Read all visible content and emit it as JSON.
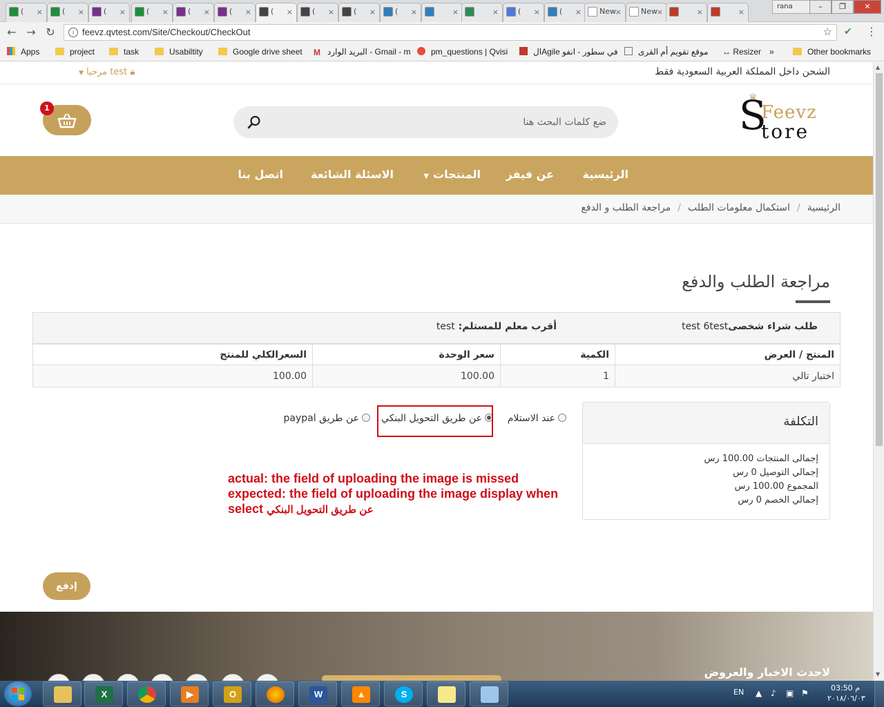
{
  "browser": {
    "tabs": [
      {
        "label": "(",
        "color": "#1e8e3e"
      },
      {
        "label": "(",
        "color": "#1e8e3e"
      },
      {
        "label": "(",
        "color": "#7a2e8e"
      },
      {
        "label": "(",
        "color": "#1e8e3e"
      },
      {
        "label": "(",
        "color": "#7a2e8e"
      },
      {
        "label": "(",
        "color": "#7a2e8e"
      },
      {
        "label": "(",
        "color": "#444444"
      },
      {
        "label": "(",
        "color": "#444444"
      },
      {
        "label": "(",
        "color": "#444444"
      },
      {
        "label": "(",
        "color": "#2f7fbf"
      },
      {
        "label": "",
        "color": "#2f7fbf"
      },
      {
        "label": "",
        "color": "#2e8b57"
      },
      {
        "label": "(",
        "color": "#4a7cd9"
      },
      {
        "label": "(",
        "color": "#2f7fbf"
      },
      {
        "label": "New",
        "color": "#ffffff"
      },
      {
        "label": "New",
        "color": "#ffffff"
      },
      {
        "label": "",
        "color": "#c0392b"
      },
      {
        "label": "",
        "color": "#c0392b"
      }
    ],
    "user": "rana",
    "url": "feevz.qvtest.com/Site/Checkout/CheckOut",
    "bookmarks": {
      "apps": "Apps",
      "project": "project",
      "task": "task",
      "usability": "Usabiltity",
      "drive": "Google drive sheet",
      "gmail": "البريد الوارد - Gmail - m",
      "pm": "pm_questions | Qvisi",
      "agile": "الAgile في سطور - انفو",
      "umm": "موقع تقويم أم القرى",
      "resizer": "↔ Resizer",
      "more": "»",
      "other": "Other bookmarks"
    }
  },
  "site": {
    "shipping_note": "الشحن داخل المملكة العربية السعودية فقط",
    "welcome": "مرحبا test",
    "logo": {
      "top": "Feevz",
      "bottom": "tore",
      "initial": "S"
    },
    "search_placeholder": "ضع كلمات البحث هنا",
    "cart_count": "1",
    "nav": {
      "home": "الرئيسية",
      "about": "عن فيفز",
      "products": "المنتجات",
      "faq": "الاسئلة الشائعة",
      "contact": "اتصل بنا"
    },
    "breadcrumb": {
      "home": "الرئيسية",
      "info": "استكمال معلومات الطلب",
      "review": "مراجعة الطلب و الدفع"
    },
    "page_title": "مراجعة الطلب والدفع",
    "order": {
      "type_label": "طلب شراء شخصى",
      "type_value": "test 6test",
      "agent_label": "أقرب معلم للمستلم:",
      "agent_value": "test"
    },
    "table": {
      "headers": {
        "product": "المنتج / العرض",
        "qty": "الكمية",
        "unit_price": "سعر الوحدة",
        "total": "السعرالكلي للمنتج"
      },
      "rows": [
        {
          "product": "اختبار تالي",
          "qty": "1",
          "unit_price": "100.00",
          "total": "100.00"
        }
      ]
    },
    "payment": {
      "on_delivery": "عند الاستلام",
      "bank_transfer": "عن طريق التحويل البنكي",
      "paypal": "عن طريق paypal"
    },
    "cost": {
      "title": "التكلفة",
      "products_total": "إجمالى المنتجات 100.00 رس",
      "delivery_total": "إجمالي التوصيل 0 رس",
      "sum": "المجموع 100.00 رس",
      "discount_total": "إجمالي الخصم 0 رس"
    },
    "annotation": {
      "line1": "actual: the field of uploading the image is missed",
      "line2": "expected: the field of uploading  the image display when",
      "line3_a": "select",
      "line3_b": "عن طريق التحويل البنكي"
    },
    "pay_button": "إدفع",
    "footer_title": "لاحدث الاخبار والعروض"
  },
  "taskbar": {
    "lang": "EN",
    "time": "03:50 م",
    "date": "٢٠١٨/٠٦/٠٣"
  },
  "colors": {
    "gold": "#c9a55f",
    "badge_red": "#d0101a",
    "annotation_red": "#d0101a"
  }
}
